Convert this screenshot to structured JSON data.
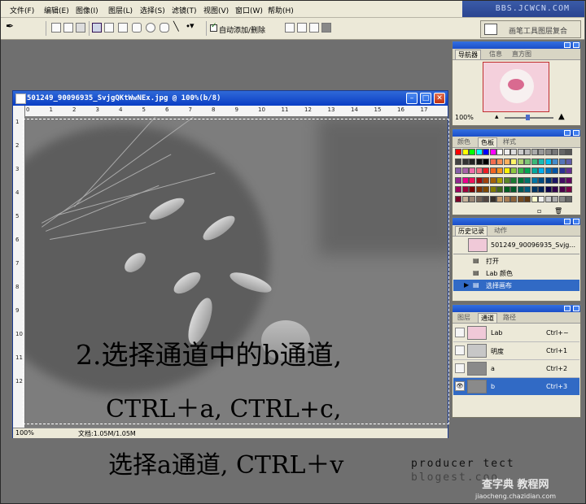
{
  "menubar": {
    "items": [
      "文件(F)",
      "编辑(E)",
      "图像(I)",
      "图层(L)",
      "选择(S)",
      "滤镜(T)",
      "视图(V)",
      "窗口(W)",
      "帮助(H)"
    ],
    "brand": "BBS.JCWCN.COM"
  },
  "options": {
    "auto_add_delete": "自动添加/删除",
    "auto_add_delete_checked": true,
    "dock_label": "画笔工具图层复合"
  },
  "document": {
    "title": "501249_90096935_SvjgQKtWwNEx.jpg @ 100%(b/8)",
    "zoom": "100%",
    "doc_size": "文档:1.05M/1.05M",
    "ruler_h": [
      "0",
      "1",
      "2",
      "3",
      "4",
      "5",
      "6",
      "7",
      "8",
      "9",
      "10",
      "11",
      "12",
      "13",
      "14",
      "15",
      "16",
      "17"
    ],
    "ruler_v": [
      "1",
      "2",
      "3",
      "4",
      "5",
      "6",
      "7",
      "8",
      "9",
      "10",
      "11",
      "12"
    ]
  },
  "overlay": {
    "line1": "2.选择通道中的b通道,",
    "line2": "CTRL＋a, CTRL+c,",
    "line3": "选择a通道, CTRL＋v"
  },
  "navigator": {
    "tabs": [
      "导航器",
      "信息",
      "直方图"
    ],
    "zoom": "100%"
  },
  "color": {
    "tabs": [
      "颜色",
      "色板",
      "样式"
    ]
  },
  "history": {
    "tabs": [
      "历史记录",
      "动作"
    ],
    "snapshot": "501249_90096935_Svjg...",
    "steps": [
      "打开",
      "Lab 颜色",
      "选择画布"
    ]
  },
  "channels": {
    "tabs": [
      "图层",
      "通道",
      "路径"
    ],
    "rows": [
      {
        "name": "Lab",
        "key": "Ctrl+~"
      },
      {
        "name": "明度",
        "key": "Ctrl+1"
      },
      {
        "name": "a",
        "key": "Ctrl+2"
      },
      {
        "name": "b",
        "key": "Ctrl+3"
      }
    ]
  },
  "watermark": {
    "line1": "producer tect",
    "line2": "blogest.coo",
    "site": "查字典 教程网",
    "url": "jiaocheng.chazidian.com"
  }
}
